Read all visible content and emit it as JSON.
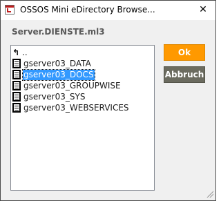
{
  "window": {
    "title": "OSSOS Mini eDirectory Browse...",
    "close_glyph": "✕"
  },
  "server": {
    "label": "Server.DIENSTE.ml3"
  },
  "list": {
    "up_item": "..",
    "items": [
      {
        "label": "gserver03_DATA",
        "selected": false
      },
      {
        "label": "gserver03_DOCS",
        "selected": true
      },
      {
        "label": "gserver03_GROUPWISE",
        "selected": false
      },
      {
        "label": "gserver03_SYS",
        "selected": false
      },
      {
        "label": "gserver03_WEBSERVICES",
        "selected": false
      }
    ]
  },
  "buttons": {
    "ok": "Ok",
    "cancel": "Abbruch"
  },
  "colors": {
    "ok_bg": "#ff9900",
    "cancel_bg": "#6b6b5f",
    "selection": "#3399ff"
  }
}
